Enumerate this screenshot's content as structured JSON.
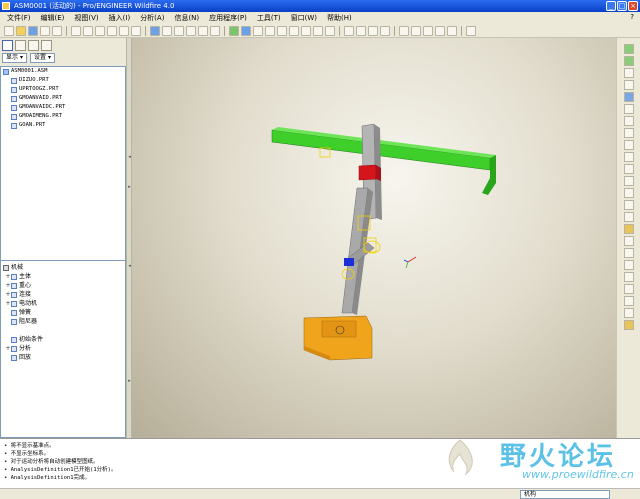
{
  "window": {
    "title": "ASM0001 (活动的) - Pro/ENGINEER Wildfire 4.0"
  },
  "menu": [
    "文件(F)",
    "编辑(E)",
    "视图(V)",
    "插入(I)",
    "分析(A)",
    "信息(N)",
    "应用程序(P)",
    "工具(T)",
    "窗口(W)",
    "帮助(H)"
  ],
  "left_panel": {
    "show_dropdown": "显示",
    "settings_dropdown": "设置",
    "model_tree": [
      "ASM0001.ASM",
      "DIZUO.PRT",
      "UPRTOOGZ.PRT",
      "GMOANVAID.PRT",
      "GMOANVAIDC.PRT",
      "GMOAIMENG.PRT",
      "GOAN.PRT"
    ],
    "mechanism_tree": {
      "root": "机械",
      "items": [
        {
          "label": "主体",
          "expander": "+"
        },
        {
          "label": "重心",
          "expander": "+"
        },
        {
          "label": "连接",
          "expander": "+"
        },
        {
          "label": "电动机",
          "expander": "+"
        },
        {
          "label": "弹簧",
          "expander": ""
        },
        {
          "label": "阻尼器",
          "expander": ""
        },
        {
          "label": "初始条件",
          "expander": ""
        },
        {
          "label": "分析",
          "expander": "+"
        },
        {
          "label": "回放",
          "expander": ""
        }
      ]
    }
  },
  "messages": [
    "• 将不显示基准点。",
    "• 不显示坐标系。",
    "• 对于运动分析将自动创建模型图纸。",
    "• AnalysisDefinition1已开始(1分析)。",
    "• AnalysisDefinition1完成。"
  ],
  "status": {
    "mode": "机构"
  },
  "watermark": {
    "title": "野火论坛",
    "url": "www.proewildfire.cn"
  },
  "colors": {
    "green_bar": "#3fcf2a",
    "base": "#f0a41c",
    "column": "#a9a9a9",
    "red_block": "#d6141c",
    "title_blue": "#0a3fc8"
  }
}
